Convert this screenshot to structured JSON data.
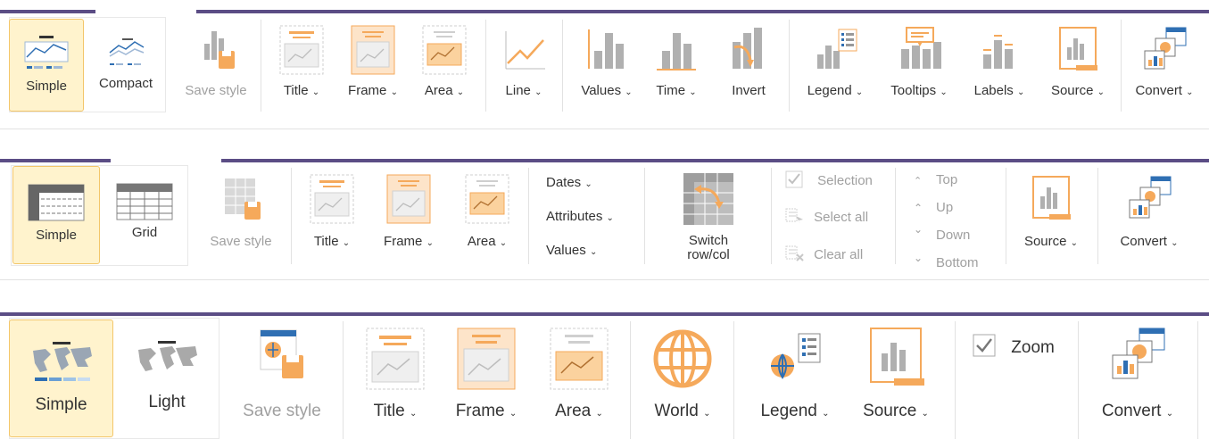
{
  "colors": {
    "accent_bar": "#5b4d85",
    "orange": "#f5a95b",
    "selected_bg": "#fff3cd",
    "selected_border": "#f3c66a",
    "gray_icon": "#a6a6a6"
  },
  "chart_toolbar": {
    "style_simple": "Simple",
    "style_compact": "Compact",
    "save_style": "Save style",
    "title": "Title",
    "frame": "Frame",
    "area": "Area",
    "line": "Line",
    "values": "Values",
    "time": "Time",
    "invert": "Invert",
    "legend": "Legend",
    "tooltips": "Tooltips",
    "labels": "Labels",
    "source": "Source",
    "convert": "Convert"
  },
  "table_toolbar": {
    "style_simple": "Simple",
    "style_grid": "Grid",
    "save_style": "Save style",
    "title": "Title",
    "frame": "Frame",
    "area": "Area",
    "dates": "Dates",
    "attributes": "Attributes",
    "values": "Values",
    "switch_line1": "Switch",
    "switch_line2": "row/col",
    "selection": "Selection",
    "select_all": "Select all",
    "clear_all": "Clear all",
    "top": "Top",
    "up": "Up",
    "down": "Down",
    "bottom": "Bottom",
    "source": "Source",
    "convert": "Convert"
  },
  "map_toolbar": {
    "style_simple": "Simple",
    "style_light": "Light",
    "save_style": "Save style",
    "title": "Title",
    "frame": "Frame",
    "area": "Area",
    "world": "World",
    "legend": "Legend",
    "source": "Source",
    "zoom": "Zoom",
    "zoom_checked": true,
    "convert": "Convert"
  },
  "chevron": "⌄"
}
